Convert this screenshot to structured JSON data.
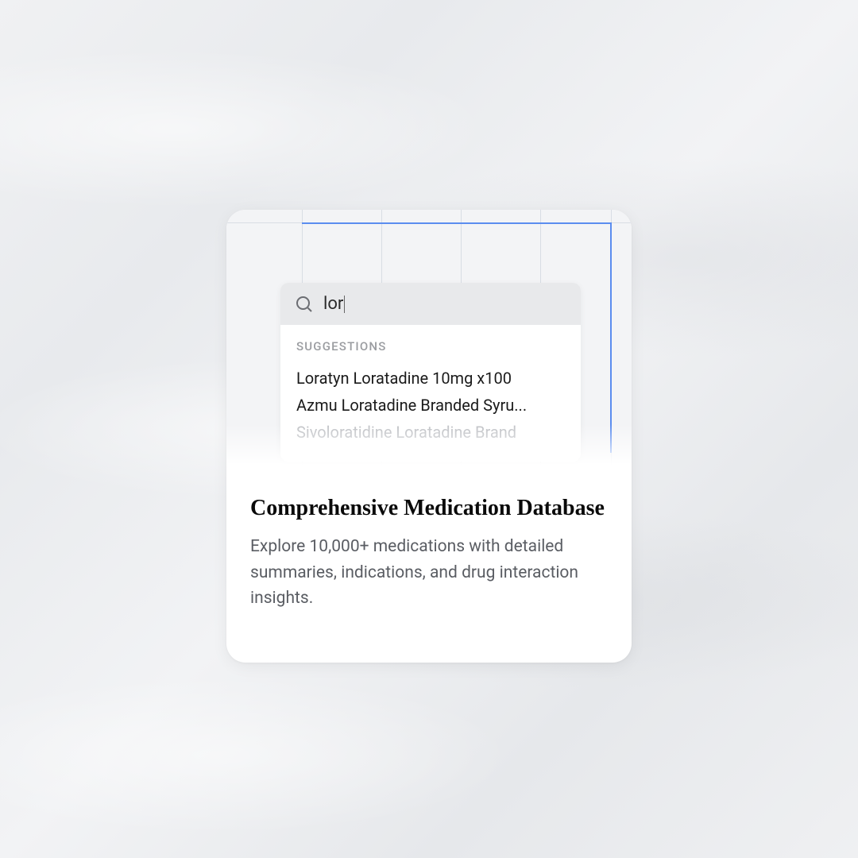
{
  "search": {
    "value": "lor",
    "placeholder": ""
  },
  "suggestions": {
    "header": "SUGGESTIONS",
    "items": [
      "Loratyn Loratadine 10mg x100",
      "Azmu Loratadine Branded Syru...",
      "Sivoloratidine Loratadine Brand"
    ]
  },
  "content": {
    "title": "Comprehensive Medication Database",
    "description": "Explore 10,000+ medications with detailed summaries, indications, and drug interaction insights."
  }
}
